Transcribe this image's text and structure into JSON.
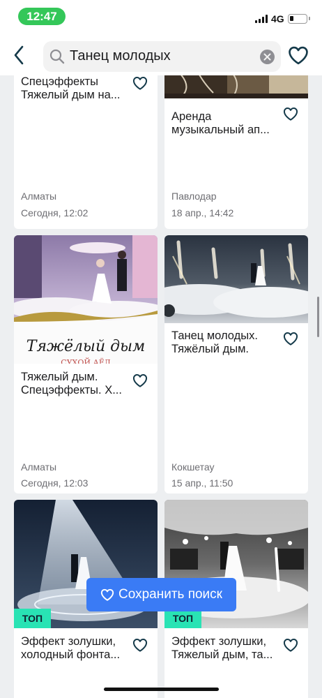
{
  "status": {
    "time": "12:47",
    "network": "4G"
  },
  "header": {
    "search_value": "Танец молодых"
  },
  "cards": [
    {
      "title": "Спецэффекты\nТяжелый дым на...",
      "city": "Алматы",
      "date": "Сегодня, 12:02"
    },
    {
      "title": "Аренда\nмузыкальный ап...",
      "city": "Павлодар",
      "date": "18 апр., 14:42"
    },
    {
      "title": "Тяжелый дым.\nСпецэффекты. Х...",
      "city": "Алматы",
      "date": "Сегодня, 12:03",
      "photo_caption": "Тяжёлый дым",
      "photo_subcaption": "СУХОЙ АЁД"
    },
    {
      "title": "Танец молодых.\nТяжёлый дым.",
      "city": "Кокшетау",
      "date": "15 апр., 11:50"
    },
    {
      "title": "Эффект золушки,\nхолодный фонта...",
      "badge": "ТОП"
    },
    {
      "title": "Эффект золушки,\nТяжелый дым, та...",
      "badge": "ТОП"
    }
  ],
  "save_search_label": "Сохранить поиск",
  "colors": {
    "accent_blue": "#3a7bf5",
    "badge_teal": "#29e3b4",
    "icon_dark": "#153a4a",
    "status_green": "#34c759"
  }
}
